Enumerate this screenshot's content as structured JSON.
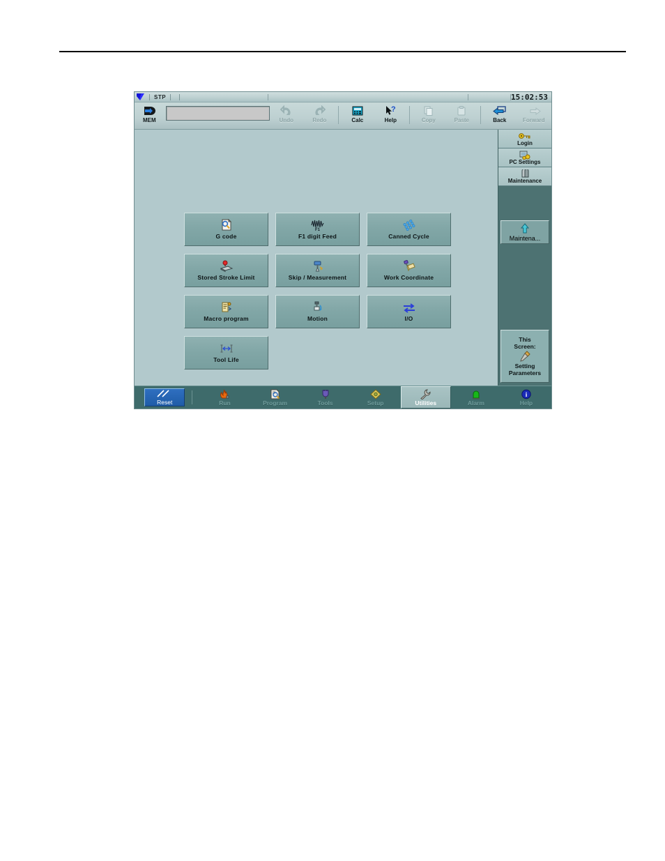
{
  "screen": {
    "status_bar": {
      "mode_ok_icon": "checkmark-icon",
      "status_text": "STP",
      "clock": "15:02:53"
    },
    "toolbar": {
      "mode_label": "MEM",
      "mode_icon": "memory-mode-icon",
      "input_value": "",
      "items": [
        {
          "label": "Undo",
          "icon": "undo-icon",
          "enabled": false
        },
        {
          "label": "Redo",
          "icon": "redo-icon",
          "enabled": false
        },
        {
          "label": "Calc",
          "icon": "calculator-icon",
          "enabled": true
        },
        {
          "label": "Help",
          "icon": "help-pointer-icon",
          "enabled": true
        },
        {
          "label": "Copy",
          "icon": "copy-icon",
          "enabled": false
        },
        {
          "label": "Paste",
          "icon": "paste-icon",
          "enabled": false
        },
        {
          "label": "Back",
          "icon": "back-arrow-icon",
          "enabled": true
        },
        {
          "label": "Forward",
          "icon": "forward-arrow-icon",
          "enabled": false
        }
      ]
    },
    "function_buttons": [
      {
        "label": "G code",
        "icon": "gcode-document-icon"
      },
      {
        "label": "F1 digit Feed",
        "icon": "f1-waveform-icon"
      },
      {
        "label": "Canned Cycle",
        "icon": "canned-cycle-grid-icon"
      },
      {
        "label": "Stored Stroke Limit",
        "icon": "stroke-limit-icon"
      },
      {
        "label": "Skip / Measurement",
        "icon": "probe-measure-icon"
      },
      {
        "label": "Work Coordinate",
        "icon": "work-coordinate-icon"
      },
      {
        "label": "Macro program",
        "icon": "macro-program-icon"
      },
      {
        "label": "Motion",
        "icon": "motion-icon"
      },
      {
        "label": "I/O",
        "icon": "io-arrows-icon"
      },
      {
        "label": "Tool Life",
        "icon": "tool-life-icon"
      }
    ],
    "sidebar": {
      "top_items": [
        {
          "label": "Login",
          "icon": "key-icon"
        },
        {
          "label": "PC Settings",
          "icon": "pc-settings-icon"
        },
        {
          "label": "Maintenance",
          "icon": "maintenance-icon"
        }
      ],
      "framed_item": {
        "label": "Maintena...",
        "icon": "up-arrow-icon"
      },
      "this_screen": {
        "title_line1": "This",
        "title_line2": "Screen:",
        "icon": "screwdriver-icon",
        "value_line1": "Setting",
        "value_line2": "Parameters"
      }
    },
    "tab_bar": {
      "reset": {
        "label": "Reset",
        "icon": "reset-slash-icon"
      },
      "tabs": [
        {
          "label": "Run",
          "icon": "run-flame-icon",
          "active": false
        },
        {
          "label": "Program",
          "icon": "program-document-icon",
          "active": false
        },
        {
          "label": "Tools",
          "icon": "tools-plug-icon",
          "active": false
        },
        {
          "label": "Setup",
          "icon": "setup-diamond-icon",
          "active": false
        },
        {
          "label": "Utilities",
          "icon": "wrench-icon",
          "active": true
        },
        {
          "label": "Alarm",
          "icon": "alarm-lamp-icon",
          "active": false
        },
        {
          "label": "Help",
          "icon": "help-info-icon",
          "active": false
        }
      ]
    }
  },
  "colors": {
    "panel_bg": "#b2c9cc",
    "button_bg": "#82a7a7",
    "toolbar_bg": "#bdd0d1",
    "sidebar_bg": "#4d7272",
    "tabbar_bg": "#3e6b6b",
    "accent_blue": "#1f5ca8"
  }
}
